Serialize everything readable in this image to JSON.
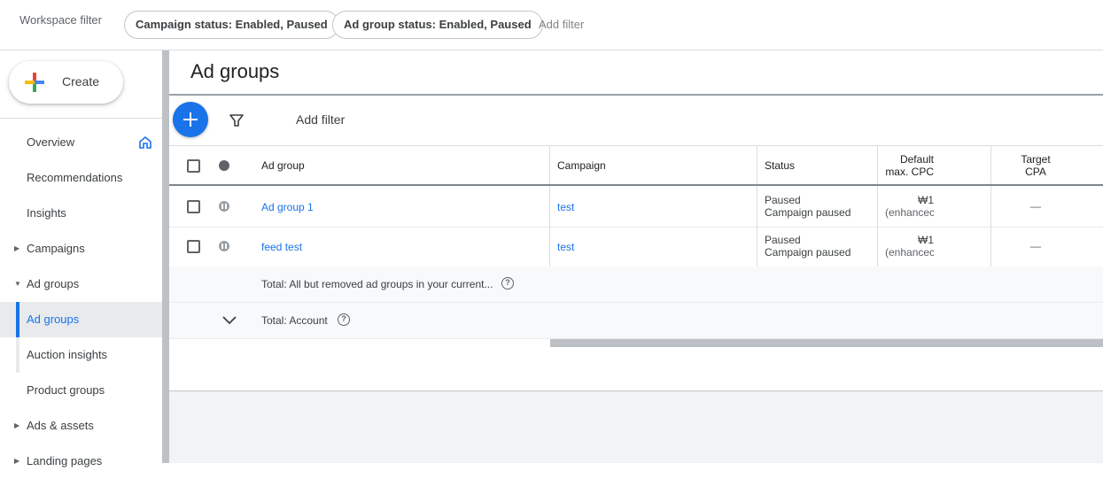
{
  "topbar": {
    "workspace_label": "Workspace filter",
    "chips": [
      "Campaign status: Enabled, Paused",
      "Ad group status: Enabled, Paused"
    ],
    "add_filter": "Add filter"
  },
  "sidebar": {
    "create_label": "Create",
    "items": [
      {
        "label": "Overview"
      },
      {
        "label": "Recommendations"
      },
      {
        "label": "Insights"
      },
      {
        "label": "Campaigns"
      },
      {
        "label": "Ad groups"
      },
      {
        "label": "Ad groups"
      },
      {
        "label": "Auction insights"
      },
      {
        "label": "Product groups"
      },
      {
        "label": "Ads & assets"
      },
      {
        "label": "Landing pages"
      }
    ]
  },
  "main": {
    "title": "Ad groups",
    "add_filter": "Add filter",
    "columns": {
      "ad_group": "Ad group",
      "campaign": "Campaign",
      "status": "Status",
      "default_cpc_line1": "Default",
      "default_cpc_line2": "max. CPC",
      "target_cpa_line1": "Target",
      "target_cpa_line2": "CPA"
    },
    "rows": [
      {
        "ad_group": "Ad group 1",
        "campaign": "test",
        "status_line1": "Paused",
        "status_line2": "Campaign paused",
        "cpc_line1": "₩1",
        "cpc_line2": "(enhancec",
        "cpa": "—"
      },
      {
        "ad_group": "feed test",
        "campaign": "test",
        "status_line1": "Paused",
        "status_line2": "Campaign paused",
        "cpc_line1": "₩1",
        "cpc_line2": "(enhancec",
        "cpa": "—"
      }
    ],
    "total_removed": "Total: All but removed ad groups in your current...",
    "total_account": "Total: Account",
    "help_glyph": "?"
  },
  "colors": {
    "accent": "#1a73e8",
    "text": "#3c4043",
    "paused": "#9aa0a6"
  }
}
